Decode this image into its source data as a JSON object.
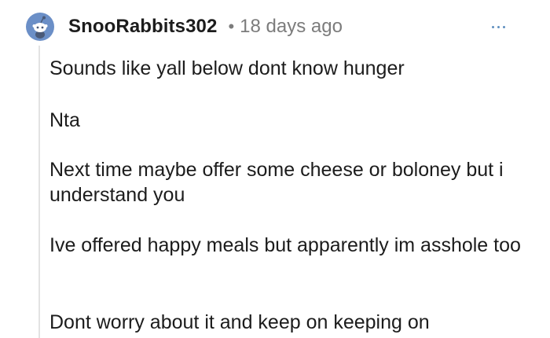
{
  "comment": {
    "username": "SnooRabbits302",
    "separator": "•",
    "timestamp": "18 days ago",
    "avatar_icon": "snoo-avatar-icon",
    "more_icon": "more-options-icon",
    "accent_color": "#5f8fbf",
    "paragraphs": [
      "Sounds like yall below dont know hunger",
      "Nta",
      "Next time maybe offer some cheese or boloney but i understand you",
      "Ive offered happy meals but apparently im asshole too",
      "Dont worry about it and keep on keeping on"
    ]
  }
}
